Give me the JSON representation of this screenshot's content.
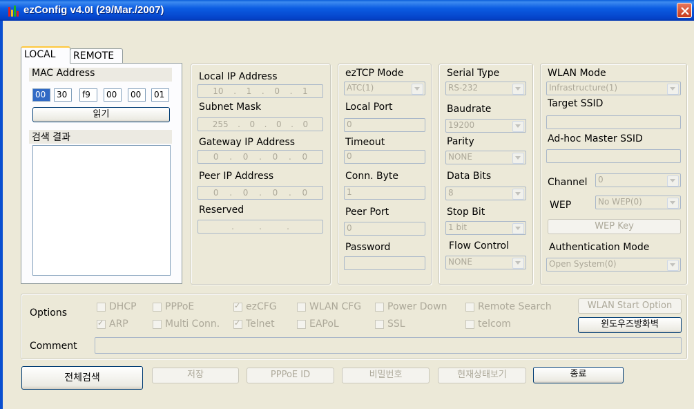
{
  "window": {
    "title": "ezConfig v4.0I (29/Mar./2007)"
  },
  "tabs": {
    "local": "LOCAL",
    "remote": "REMOTE"
  },
  "local_panel": {
    "mac_label": "MAC Address",
    "mac": [
      "00",
      "30",
      "f9",
      "00",
      "00",
      "01"
    ],
    "read_button": "읽기",
    "search_result_label": "검색 결과"
  },
  "ip_panel": {
    "local_ip_label": "Local IP Address",
    "local_ip": [
      "10",
      "1",
      "0",
      "1"
    ],
    "subnet_label": "Subnet Mask",
    "subnet": [
      "255",
      "0",
      "0",
      "0"
    ],
    "gateway_label": "Gateway IP Address",
    "gateway": [
      "0",
      "0",
      "0",
      "0"
    ],
    "peer_ip_label": "Peer IP Address",
    "peer_ip": [
      "0",
      "0",
      "0",
      "0"
    ],
    "reserved_label": "Reserved",
    "reserved": [
      ".",
      ".",
      "."
    ]
  },
  "eztcp_panel": {
    "mode_label": "ezTCP Mode",
    "mode_value": "ATC(1)",
    "local_port_label": "Local Port",
    "local_port": "0",
    "timeout_label": "Timeout",
    "timeout": "0",
    "conn_byte_label": "Conn. Byte",
    "conn_byte": "1",
    "peer_port_label": "Peer Port",
    "peer_port": "0",
    "password_label": "Password",
    "password": ""
  },
  "serial_panel": {
    "type_label": "Serial Type",
    "type_value": "RS-232",
    "baud_label": "Baudrate",
    "baud_value": "19200",
    "parity_label": "Parity",
    "parity_value": "NONE",
    "databits_label": "Data Bits",
    "databits_value": "8",
    "stopbit_label": "Stop Bit",
    "stopbit_value": "1 bit",
    "flow_label": "Flow Control",
    "flow_value": "NONE"
  },
  "wlan_panel": {
    "mode_label": "WLAN Mode",
    "mode_value": "Infrastructure(1)",
    "ssid_label": "Target SSID",
    "ssid": "",
    "adhoc_label": "Ad-hoc Master SSID",
    "adhoc": "",
    "channel_label": "Channel",
    "channel_value": "0",
    "wep_label": "WEP",
    "wep_value": "No WEP(0)",
    "wep_key_button": "WEP Key",
    "auth_label": "Authentication Mode",
    "auth_value": "Open System(0)"
  },
  "options": {
    "label": "Options",
    "row1": [
      {
        "label": "DHCP",
        "checked": false
      },
      {
        "label": "PPPoE",
        "checked": false
      },
      {
        "label": "ezCFG",
        "checked": true
      },
      {
        "label": "WLAN CFG",
        "checked": false
      },
      {
        "label": "Power Down",
        "checked": false
      },
      {
        "label": "Remote Search",
        "checked": false
      }
    ],
    "row2": [
      {
        "label": "ARP",
        "checked": true
      },
      {
        "label": "Multi Conn.",
        "checked": false
      },
      {
        "label": "Telnet",
        "checked": true
      },
      {
        "label": "EAPoL",
        "checked": false
      },
      {
        "label": "SSL",
        "checked": false
      },
      {
        "label": "telcom",
        "checked": false
      }
    ],
    "wlan_start_button": "WLAN Start Option",
    "firewall_button": "윈도우즈방화벽",
    "comment_label": "Comment",
    "comment": ""
  },
  "bottom_buttons": {
    "search_all": "전체검색",
    "save": "저장",
    "pppoe_id": "PPPoE ID",
    "password": "비밀번호",
    "status": "현재상태보기",
    "exit": "종료"
  }
}
